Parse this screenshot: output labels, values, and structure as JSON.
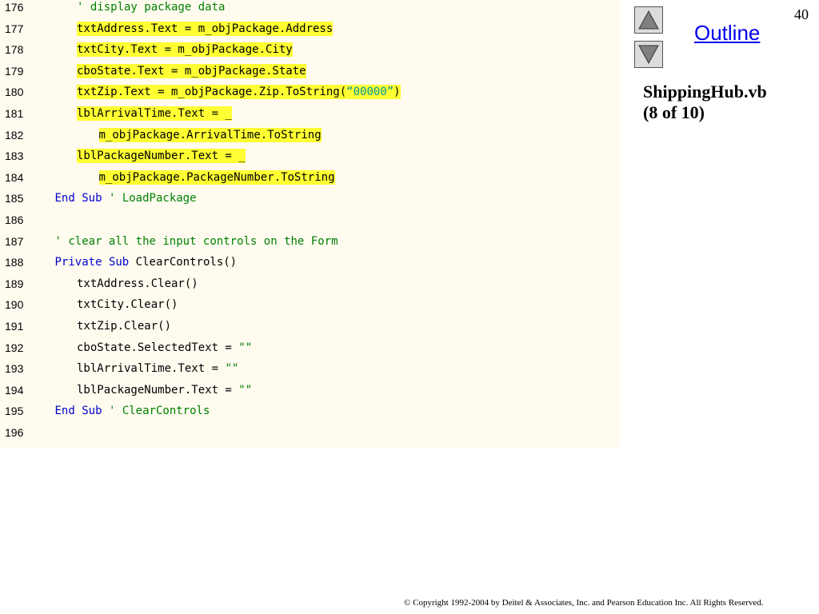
{
  "page_number": "40",
  "outline": {
    "title": "Outline"
  },
  "file": {
    "name": "ShippingHub.vb",
    "part": "(8 of 10)"
  },
  "nav": {
    "up_icon": "triangle-up-icon",
    "down_icon": "triangle-down-icon"
  },
  "colors": {
    "code_background": "#fffbef",
    "highlight": "#ffff33",
    "keyword": "#0000cc",
    "comment": "#008000",
    "string": "#009999",
    "link": "#0000ee"
  },
  "code": {
    "lines": [
      {
        "num": "176",
        "indent": 2,
        "highlight": false,
        "segments": [
          {
            "t": "' display package data",
            "c": "cm"
          }
        ]
      },
      {
        "num": "177",
        "indent": 2,
        "highlight": true,
        "segments": [
          {
            "t": "txtAddress.Text = m_objPackage.Address",
            "c": ""
          }
        ]
      },
      {
        "num": "178",
        "indent": 2,
        "highlight": true,
        "segments": [
          {
            "t": "txtCity.Text = m_objPackage.City",
            "c": ""
          }
        ]
      },
      {
        "num": "179",
        "indent": 2,
        "highlight": true,
        "segments": [
          {
            "t": "cboState.Text = m_objPackage.State",
            "c": ""
          }
        ]
      },
      {
        "num": "180",
        "indent": 2,
        "highlight": true,
        "segments": [
          {
            "t": "txtZip.Text = m_objPackage.Zip.ToString(",
            "c": ""
          },
          {
            "t": "“00000”",
            "c": "str"
          },
          {
            "t": ")",
            "c": ""
          }
        ]
      },
      {
        "num": "181",
        "indent": 2,
        "highlight": true,
        "segments": [
          {
            "t": "lblArrivalTime.Text = _",
            "c": ""
          }
        ]
      },
      {
        "num": "182",
        "indent": 3,
        "highlight": true,
        "segments": [
          {
            "t": "m_objPackage.ArrivalTime.ToString",
            "c": ""
          }
        ]
      },
      {
        "num": "183",
        "indent": 2,
        "highlight": true,
        "segments": [
          {
            "t": "lblPackageNumber.Text = _",
            "c": ""
          }
        ]
      },
      {
        "num": "184",
        "indent": 3,
        "highlight": true,
        "segments": [
          {
            "t": "m_objPackage.PackageNumber.ToString",
            "c": ""
          }
        ]
      },
      {
        "num": "185",
        "indent": 1,
        "highlight": false,
        "segments": [
          {
            "t": "End",
            "c": "kw"
          },
          {
            "t": " ",
            "c": ""
          },
          {
            "t": "Sub",
            "c": "kw"
          },
          {
            "t": " ",
            "c": ""
          },
          {
            "t": "' LoadPackage",
            "c": "cm"
          }
        ]
      },
      {
        "num": "186",
        "indent": 1,
        "highlight": false,
        "segments": []
      },
      {
        "num": "187",
        "indent": 1,
        "highlight": false,
        "segments": [
          {
            "t": "' clear all the input controls on the Form",
            "c": "cm"
          }
        ]
      },
      {
        "num": "188",
        "indent": 1,
        "highlight": false,
        "segments": [
          {
            "t": "Private",
            "c": "kw"
          },
          {
            "t": " ",
            "c": ""
          },
          {
            "t": "Sub",
            "c": "kw"
          },
          {
            "t": " ClearControls()",
            "c": ""
          }
        ]
      },
      {
        "num": "189",
        "indent": 2,
        "highlight": false,
        "segments": [
          {
            "t": "txtAddress.Clear()",
            "c": ""
          }
        ]
      },
      {
        "num": "190",
        "indent": 2,
        "highlight": false,
        "segments": [
          {
            "t": "txtCity.Clear()",
            "c": ""
          }
        ]
      },
      {
        "num": "191",
        "indent": 2,
        "highlight": false,
        "segments": [
          {
            "t": "txtZip.Clear()",
            "c": ""
          }
        ]
      },
      {
        "num": "192",
        "indent": 2,
        "highlight": false,
        "segments": [
          {
            "t": "cboState.SelectedText = ",
            "c": ""
          },
          {
            "t": "\"\"",
            "c": "sq"
          }
        ]
      },
      {
        "num": "193",
        "indent": 2,
        "highlight": false,
        "segments": [
          {
            "t": "lblArrivalTime.Text = ",
            "c": ""
          },
          {
            "t": "\"\"",
            "c": "sq"
          }
        ]
      },
      {
        "num": "194",
        "indent": 2,
        "highlight": false,
        "segments": [
          {
            "t": "lblPackageNumber.Text = ",
            "c": ""
          },
          {
            "t": "\"\"",
            "c": "sq"
          }
        ]
      },
      {
        "num": "195",
        "indent": 1,
        "highlight": false,
        "segments": [
          {
            "t": "End",
            "c": "kw"
          },
          {
            "t": " ",
            "c": ""
          },
          {
            "t": "Sub",
            "c": "kw"
          },
          {
            "t": " ",
            "c": ""
          },
          {
            "t": "' ClearControls",
            "c": "cm"
          }
        ]
      },
      {
        "num": "196",
        "indent": 1,
        "highlight": false,
        "segments": []
      }
    ]
  },
  "footer": {
    "copyright": "© Copyright 1992-2004 by Deitel & Associates, Inc. and Pearson Education Inc. All Rights Reserved."
  }
}
